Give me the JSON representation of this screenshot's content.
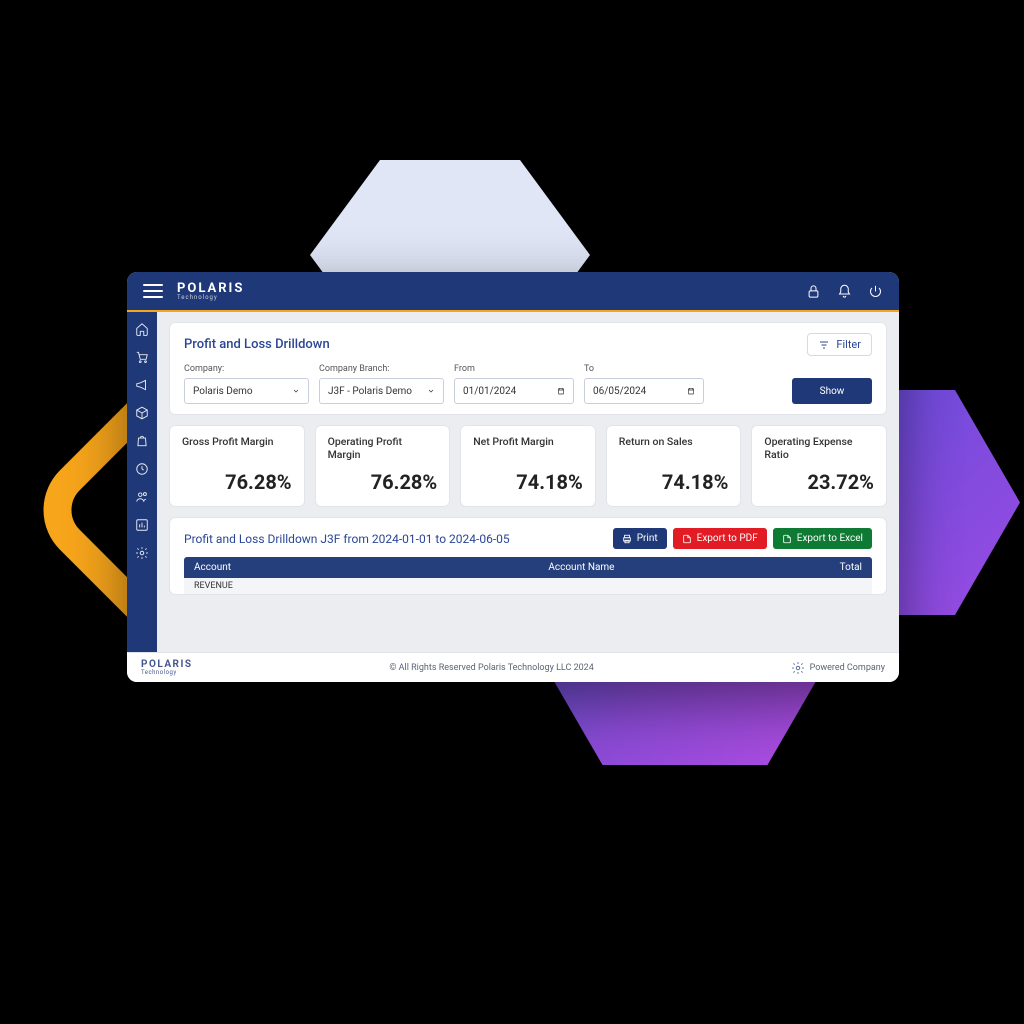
{
  "brand": {
    "name": "POLARIS",
    "sub": "Technology"
  },
  "page": {
    "title": "Profit and Loss Drilldown",
    "filter_button": "Filter"
  },
  "filters": {
    "company_label": "Company:",
    "company_value": "Polaris Demo",
    "branch_label": "Company Branch:",
    "branch_value": "J3F - Polaris Demo",
    "from_label": "From",
    "from_value": "01/01/2024",
    "to_label": "To",
    "to_value": "06/05/2024",
    "show_label": "Show"
  },
  "metrics": [
    {
      "label": "Gross Profit Margin",
      "value": "76.28%"
    },
    {
      "label": "Operating Profit Margin",
      "value": "76.28%"
    },
    {
      "label": "Net Profit Margin",
      "value": "74.18%"
    },
    {
      "label": "Return on Sales",
      "value": "74.18%"
    },
    {
      "label": "Operating Expense Ratio",
      "value": "23.72%"
    }
  ],
  "report": {
    "title": "Profit and Loss Drilldown J3F from 2024-01-01 to 2024-06-05",
    "print": "Print",
    "pdf": "Export to PDF",
    "excel": "Export to Excel",
    "columns": {
      "account": "Account",
      "name": "Account Name",
      "total": "Total"
    },
    "first_row": "REVENUE"
  },
  "footer": {
    "copyright": "© All Rights Reserved Polaris Technology LLC 2024",
    "powered": "Powered Company"
  },
  "sidebar_icons": [
    "home-icon",
    "cart-icon",
    "announce-icon",
    "box-icon",
    "bag-icon",
    "clock-icon",
    "users-icon",
    "chart-icon",
    "settings-icon"
  ],
  "colors": {
    "primary": "#1f3978",
    "accent": "#f7a51b",
    "danger": "#e21c24",
    "success": "#0f7a33"
  }
}
